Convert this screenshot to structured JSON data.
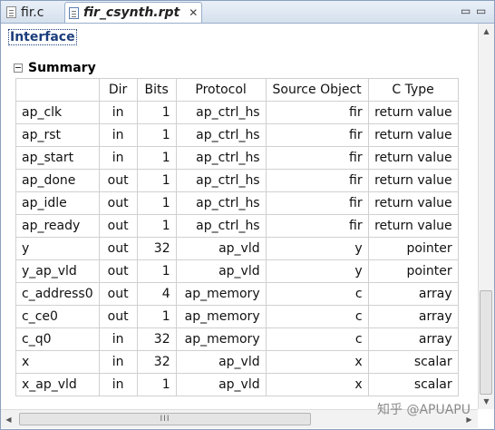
{
  "tabs": [
    {
      "label": "fir.c"
    },
    {
      "label": "fir_csynth.rpt",
      "close": "✕"
    }
  ],
  "window_controls": {
    "minimize": "▭",
    "maximize": "▭"
  },
  "section_title": "Interface",
  "summary_title": "Summary",
  "table": {
    "headers": [
      "",
      "Dir",
      "Bits",
      "Protocol",
      "Source Object",
      "C Type"
    ],
    "rows": [
      [
        "ap_clk",
        "in",
        "1",
        "ap_ctrl_hs",
        "fir",
        "return value"
      ],
      [
        "ap_rst",
        "in",
        "1",
        "ap_ctrl_hs",
        "fir",
        "return value"
      ],
      [
        "ap_start",
        "in",
        "1",
        "ap_ctrl_hs",
        "fir",
        "return value"
      ],
      [
        "ap_done",
        "out",
        "1",
        "ap_ctrl_hs",
        "fir",
        "return value"
      ],
      [
        "ap_idle",
        "out",
        "1",
        "ap_ctrl_hs",
        "fir",
        "return value"
      ],
      [
        "ap_ready",
        "out",
        "1",
        "ap_ctrl_hs",
        "fir",
        "return value"
      ],
      [
        "y",
        "out",
        "32",
        "ap_vld",
        "y",
        "pointer"
      ],
      [
        "y_ap_vld",
        "out",
        "1",
        "ap_vld",
        "y",
        "pointer"
      ],
      [
        "c_address0",
        "out",
        "4",
        "ap_memory",
        "c",
        "array"
      ],
      [
        "c_ce0",
        "out",
        "1",
        "ap_memory",
        "c",
        "array"
      ],
      [
        "c_q0",
        "in",
        "32",
        "ap_memory",
        "c",
        "array"
      ],
      [
        "x",
        "in",
        "32",
        "ap_vld",
        "x",
        "scalar"
      ],
      [
        "x_ap_vld",
        "in",
        "1",
        "ap_vld",
        "x",
        "scalar"
      ]
    ]
  },
  "scrollbar": {
    "grip": "III"
  },
  "watermark": "知乎 @APUAPU"
}
